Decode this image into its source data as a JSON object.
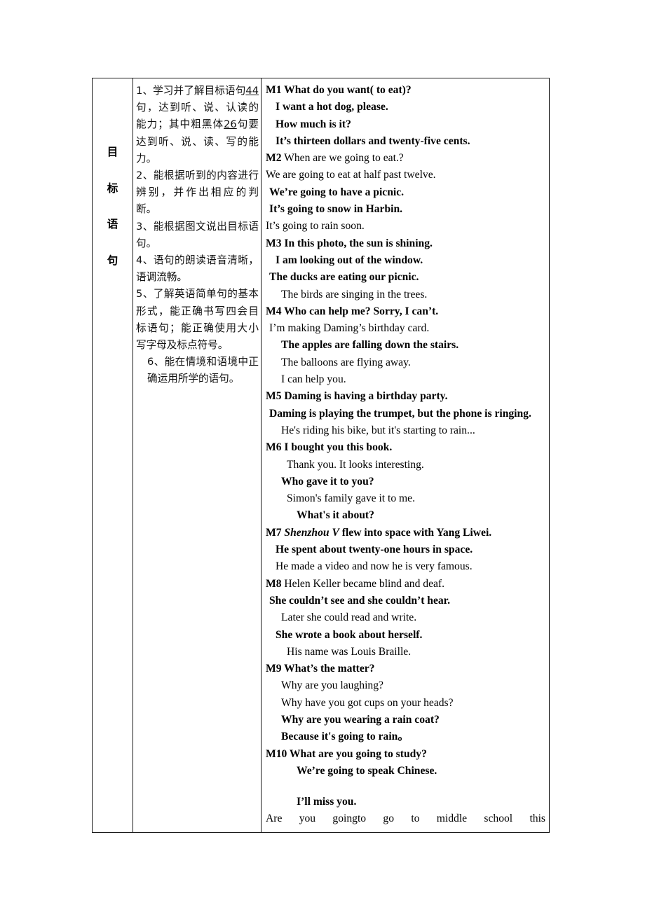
{
  "document": {
    "type": "teaching-plan-table",
    "row_header_label": "目标语句",
    "row_header_chars": [
      "目",
      "标",
      "语",
      "句"
    ]
  },
  "goals": {
    "items": [
      {
        "id": "goal-1",
        "prefix": "1、",
        "text_before_first_number": "学习并了解目标语句",
        "number_1": "44",
        "text_middle": "句，达到听、说、认读的能力；其中粗黑体",
        "number_2": "26",
        "text_after": "句要达到听、说、读、写的能力。",
        "full": "1、学习并了解目标语句44句，达到听、说、认读的能力；其中粗黑体26句要达到听、说、读、写的能力。"
      },
      {
        "id": "goal-2",
        "full": "2、能根据听到的内容进行辨别，并作出相应的判断。"
      },
      {
        "id": "goal-3",
        "full": "3、能根据图文说出目标语句。"
      },
      {
        "id": "goal-4",
        "full": "4、语句的朗读语音清晰，语调流畅。"
      },
      {
        "id": "goal-5",
        "full": "5、了解英语简单句的基本形式，能正确书写四会目标语句；能正确使用大小写字母及标点符号。"
      },
      {
        "id": "goal-6",
        "full": "6、能在情境和语境中正确运用所学的语句。"
      }
    ]
  },
  "sentences": {
    "lines": [
      {
        "id": "m1-q",
        "text": "M1 What do you want( to eat)?",
        "bold": true,
        "indent": 0
      },
      {
        "id": "m1-a1",
        "text": "I want a hot dog, please.",
        "bold": true,
        "indent": 2
      },
      {
        "id": "m1-a2",
        "text": "How much is it?",
        "bold": true,
        "indent": 2
      },
      {
        "id": "m1-a3",
        "text": "It’s thirteen dollars and twenty-five cents.",
        "bold": true,
        "indent": 2
      },
      {
        "id": "m2-q",
        "text": "M2 When are we going to eat.?",
        "bold": false,
        "indent": 0,
        "label": "M2"
      },
      {
        "id": "m2-a1",
        "text": "We are going to eat at half past twelve.",
        "bold": false,
        "indent": 0
      },
      {
        "id": "m2-a2",
        "text": "We’re going to have a picnic.",
        "bold": true,
        "indent": 1
      },
      {
        "id": "m2-a3",
        "text": "It’s going to snow in Harbin.",
        "bold": true,
        "indent": 1
      },
      {
        "id": "m2-a4",
        "text": "It’s going to rain soon.",
        "bold": false,
        "indent": 0
      },
      {
        "id": "m3-q",
        "text": "M3 In this photo, the sun is shining.",
        "bold": true,
        "indent": 0
      },
      {
        "id": "m3-a1",
        "text": "I am looking out of the window.",
        "bold": true,
        "indent": 2
      },
      {
        "id": "m3-a2",
        "text": "The ducks are eating our picnic.",
        "bold": true,
        "indent": 1
      },
      {
        "id": "m3-a3",
        "text": "The birds are singing in the trees.",
        "bold": false,
        "indent": 3
      },
      {
        "id": "m4-q",
        "text": "M4 Who can help me? Sorry, I can’t.",
        "bold": true,
        "indent": 0
      },
      {
        "id": "m4-a1",
        "text": "I’m making Daming’s birthday card.",
        "bold": false,
        "indent": 1
      },
      {
        "id": "m4-a2",
        "text": "The apples are falling down the stairs.",
        "bold": true,
        "indent": 3
      },
      {
        "id": "m4-a3",
        "text": "The balloons are flying away.",
        "bold": false,
        "indent": 3
      },
      {
        "id": "m4-a4",
        "text": "I can help you.",
        "bold": false,
        "indent": 3
      },
      {
        "id": "m5-q",
        "text": "M5 Daming is having a birthday party.",
        "bold": true,
        "indent": 0
      },
      {
        "id": "m5-a1",
        "text": "Daming is playing the trumpet, but the phone is ringing.",
        "bold": true,
        "indent": 1,
        "wraps": true
      },
      {
        "id": "m5-a2",
        "text": "He's riding his bike, but it's starting to rain...",
        "bold": false,
        "indent": 3
      },
      {
        "id": "m6-q",
        "text": "M6 I bought you this book.",
        "bold": true,
        "indent": 0
      },
      {
        "id": "m6-a1",
        "text": "Thank you. It looks interesting.",
        "bold": false,
        "indent": 4
      },
      {
        "id": "m6-a2",
        "text": "Who gave it to you?",
        "bold": true,
        "indent": 3
      },
      {
        "id": "m6-a3",
        "text": "Simon's family gave it to me.",
        "bold": false,
        "indent": 4
      },
      {
        "id": "m6-a4",
        "text": "What's it about?",
        "bold": true,
        "indent": 5
      },
      {
        "id": "m7-q",
        "text": "M7 Shenzhou V flew into space with Yang Liwei.",
        "bold": true,
        "indent": 0,
        "italic_part": "Shenzhou V",
        "prefix": "M7 ",
        "suffix": " flew into space with Yang Liwei."
      },
      {
        "id": "m7-a1",
        "text": "He spent about twenty-one hours in space.",
        "bold": true,
        "indent": 2
      },
      {
        "id": "m7-a2",
        "text": "He made a video and now he is very famous.",
        "bold": false,
        "indent": 2
      },
      {
        "id": "m8-q",
        "text": "M8 Helen Keller became blind and deaf.",
        "bold": false,
        "indent": 0,
        "label": "M8"
      },
      {
        "id": "m8-a1",
        "text": "She couldn’t see and she couldn’t hear.",
        "bold": true,
        "indent": 1
      },
      {
        "id": "m8-a2",
        "text": "Later she could read and write.",
        "bold": false,
        "indent": 3
      },
      {
        "id": "m8-a3",
        "text": "She wrote a book about herself.",
        "bold": true,
        "indent": 2
      },
      {
        "id": "m8-a4",
        "text": "His name was Louis Braille.",
        "bold": false,
        "indent": 4
      },
      {
        "id": "m9-q",
        "text": "M9 What’s the matter?",
        "bold": true,
        "indent": 0
      },
      {
        "id": "m9-a1",
        "text": "Why are you laughing?",
        "bold": false,
        "indent": 3
      },
      {
        "id": "m9-a2",
        "text": "Why have you got cups on your heads?",
        "bold": false,
        "indent": 3
      },
      {
        "id": "m9-a3",
        "text": "Why are you wearing a rain coat?",
        "bold": true,
        "indent": 3
      },
      {
        "id": "m9-a4",
        "text": "Because it's going to rain。",
        "bold": true,
        "indent": 3
      },
      {
        "id": "m10-q",
        "text": "M10 What are you going to study?",
        "bold": true,
        "indent": 0
      },
      {
        "id": "m10-a1",
        "text": "We’re going to speak Chinese.",
        "bold": true,
        "indent": 5
      },
      {
        "id": "m10-a2",
        "text": "I’ll miss you.",
        "bold": true,
        "indent": 5,
        "extra_space_before": true
      },
      {
        "id": "m10-a3",
        "text": "Are you goingto go to middle school this",
        "bold": false,
        "indent": 0,
        "justified": true
      }
    ]
  }
}
